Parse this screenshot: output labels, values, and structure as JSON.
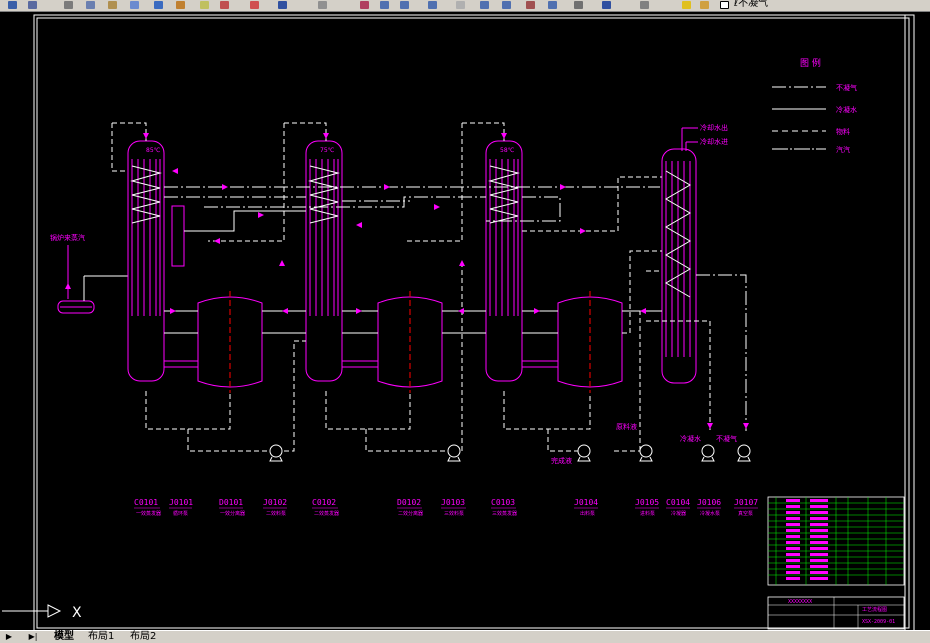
{
  "toolbar": {
    "partial_text": "ℓ不凝气",
    "icons": [
      "save-icon",
      "print-icon",
      "cut-icon",
      "copy-icon",
      "paste-icon",
      "undo-icon",
      "redo-icon",
      "pan-icon",
      "zoom-icon",
      "zoom-window-icon",
      "zoom-previous-icon",
      "properties-icon",
      "layers-icon",
      "table-icon",
      "help-icon",
      "layer-state-icon",
      "lightbulb-icon"
    ]
  },
  "legend": {
    "title": "图  例",
    "items": [
      "不凝气",
      "冷凝水",
      "物料",
      "汽汽"
    ]
  },
  "labels": {
    "steam_source": "锅炉来蒸汽",
    "cooling_water_out": "冷却水出",
    "cooling_water_in": "冷却水进",
    "temp1": "85℃",
    "temp2": "75℃",
    "temp3": "58℃",
    "product_liquid": "完成液",
    "raw_liquid": "原料液",
    "cooling_water": "冷凝水",
    "noncondensable": "不凝气"
  },
  "equipment": [
    {
      "tag": "C0101",
      "name": "一效蒸发器"
    },
    {
      "tag": "J0101",
      "name": "循环泵"
    },
    {
      "tag": "D0101",
      "name": "一效分离器"
    },
    {
      "tag": "J0102",
      "name": "二效料泵"
    },
    {
      "tag": "C0102",
      "name": "二效蒸发器"
    },
    {
      "tag": "D0102",
      "name": "二效分离器"
    },
    {
      "tag": "J0103",
      "name": "三效料泵"
    },
    {
      "tag": "C0103",
      "name": "三效蒸发器"
    },
    {
      "tag": "J0104",
      "name": "出料泵"
    },
    {
      "tag": "J0105",
      "name": "进料泵"
    },
    {
      "tag": "C0104",
      "name": "冷凝器"
    },
    {
      "tag": "J0106",
      "name": "冷凝水泵"
    },
    {
      "tag": "J0107",
      "name": "真空泵"
    }
  ],
  "title_block": {
    "school": "XXXXXXXX",
    "drawing_name": "工艺流程图",
    "drawing_no": "XSX-2009-01"
  },
  "command": {
    "ucs_label": "X"
  },
  "tabs": [
    {
      "label": "模型"
    },
    {
      "label": "布局1"
    },
    {
      "label": "布局2"
    }
  ],
  "colors": {
    "magenta": "#ff00ff",
    "white": "#ffffff",
    "background": "#000000",
    "green": "#00ff00"
  }
}
